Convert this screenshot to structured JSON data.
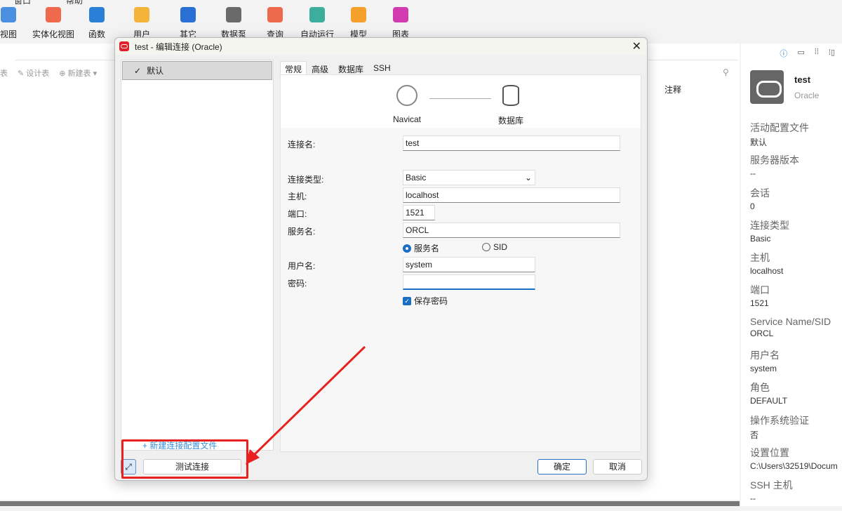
{
  "menu": [
    "窗口",
    "帮助"
  ],
  "toolbar": [
    {
      "label": "视图",
      "color": "#4a8fe0"
    },
    {
      "label": "实体化视图",
      "color": "#ef6a4d"
    },
    {
      "label": "函数",
      "color": "#2a7fd6"
    },
    {
      "label": "用户",
      "color": "#f4b43a"
    },
    {
      "label": "其它",
      "color": "#2a6fd6"
    },
    {
      "label": "数据泵",
      "color": "#6a6a6a"
    },
    {
      "label": "查询",
      "color": "#ef6a4d"
    },
    {
      "label": "自动运行",
      "color": "#3cae9c"
    },
    {
      "label": "模型",
      "color": "#f4a02a"
    },
    {
      "label": "图表",
      "color": "#d23ab0"
    }
  ],
  "subtoolbar": [
    "表",
    "设计表",
    "新建表"
  ],
  "column_header": "注释",
  "dialog": {
    "title": "test - 编辑连接 (Oracle)",
    "profile": "默认",
    "new_profile": "新建连接配置文件",
    "tabs": [
      "常规",
      "高级",
      "数据库",
      "SSH"
    ],
    "navicat": "Navicat",
    "database": "数据库",
    "fields": {
      "conn_name_label": "连接名:",
      "conn_name": "test",
      "conn_type_label": "连接类型:",
      "conn_type": "Basic",
      "host_label": "主机:",
      "host": "localhost",
      "port_label": "端口:",
      "port": "1521",
      "service_label": "服务名:",
      "service": "ORCL",
      "radio_service": "服务名",
      "radio_sid": "SID",
      "user_label": "用户名:",
      "user": "system",
      "pwd_label": "密码:",
      "pwd": "",
      "save_pwd": "保存密码"
    },
    "test_btn": "测试连接",
    "ok": "确定",
    "cancel": "取消"
  },
  "right_panel": {
    "name": "test",
    "type": "Oracle",
    "fields": [
      {
        "label": "活动配置文件",
        "value": "默认"
      },
      {
        "label": "服务器版本",
        "value": "--"
      },
      {
        "label": "会话",
        "value": "0"
      },
      {
        "label": "连接类型",
        "value": "Basic"
      },
      {
        "label": "主机",
        "value": "localhost"
      },
      {
        "label": "端口",
        "value": "1521"
      },
      {
        "label": "Service Name/SID",
        "value": "ORCL"
      },
      {
        "label": "用户名",
        "value": "system"
      },
      {
        "label": "角色",
        "value": "DEFAULT"
      },
      {
        "label": "操作系统验证",
        "value": "否"
      },
      {
        "label": "设置位置",
        "value": "C:\\Users\\32519\\Docum"
      },
      {
        "label": "SSH 主机",
        "value": "--"
      }
    ]
  }
}
